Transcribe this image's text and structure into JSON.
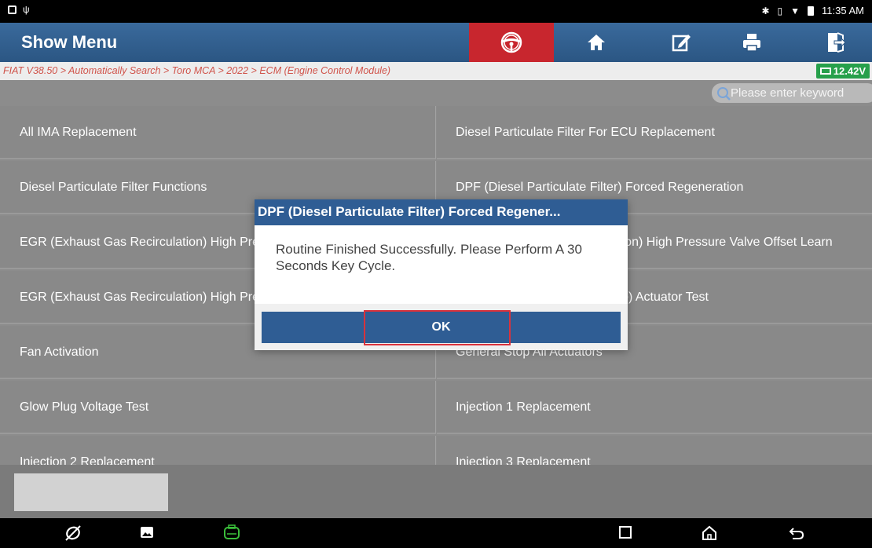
{
  "status_bar": {
    "time": "11:35 AM"
  },
  "header": {
    "title": "Show Menu",
    "toolbar": [
      {
        "icon": "steering-wheel-icon",
        "active": true,
        "color": "#c8262e"
      },
      {
        "icon": "home-icon"
      },
      {
        "icon": "edit-report-icon"
      },
      {
        "icon": "print-icon"
      },
      {
        "icon": "exit-icon"
      }
    ]
  },
  "breadcrumb": {
    "path": "FIAT V38.50 > Automatically Search > Toro MCA > 2022 > ECM (Engine Control Module)",
    "voltage": "12.42V",
    "voltage_color": "#27a04b"
  },
  "search": {
    "placeholder": "Please enter keyword"
  },
  "menu": {
    "items": [
      "All IMA Replacement",
      "Diesel Particulate Filter For ECU Replacement",
      "Diesel Particulate Filter Functions",
      "DPF (Diesel Particulate Filter) Forced Regeneration",
      "EGR (Exhaust Gas Recirculation) High Pressure Valve Offset Learn",
      "EGR (Exhaust Gas Recirculation) High Pressure Valve Offset Learn",
      "EGR (Exhaust Gas Recirculation) High Pressure Valve Test",
      "VGT (Variable Geometry Turbo) Actuator Test",
      "Fan Activation",
      "General Stop All Actuators",
      "Glow Plug Voltage Test",
      "Injection 1 Replacement",
      "Injection 2 Replacement",
      "Injection 3 Replacement"
    ]
  },
  "dialog": {
    "title": "DPF (Diesel Particulate Filter) Forced Regener...",
    "message": "Routine Finished Successfully. Please Perform A 30 Seconds Key Cycle.",
    "ok_label": "OK",
    "header_color": "#2f5d94",
    "highlight_color": "#d9323c"
  },
  "nav_bar": {
    "icons": [
      "browser-icon",
      "gallery-icon",
      "vci-icon",
      "recents-icon",
      "home-nav-icon",
      "back-icon"
    ]
  }
}
